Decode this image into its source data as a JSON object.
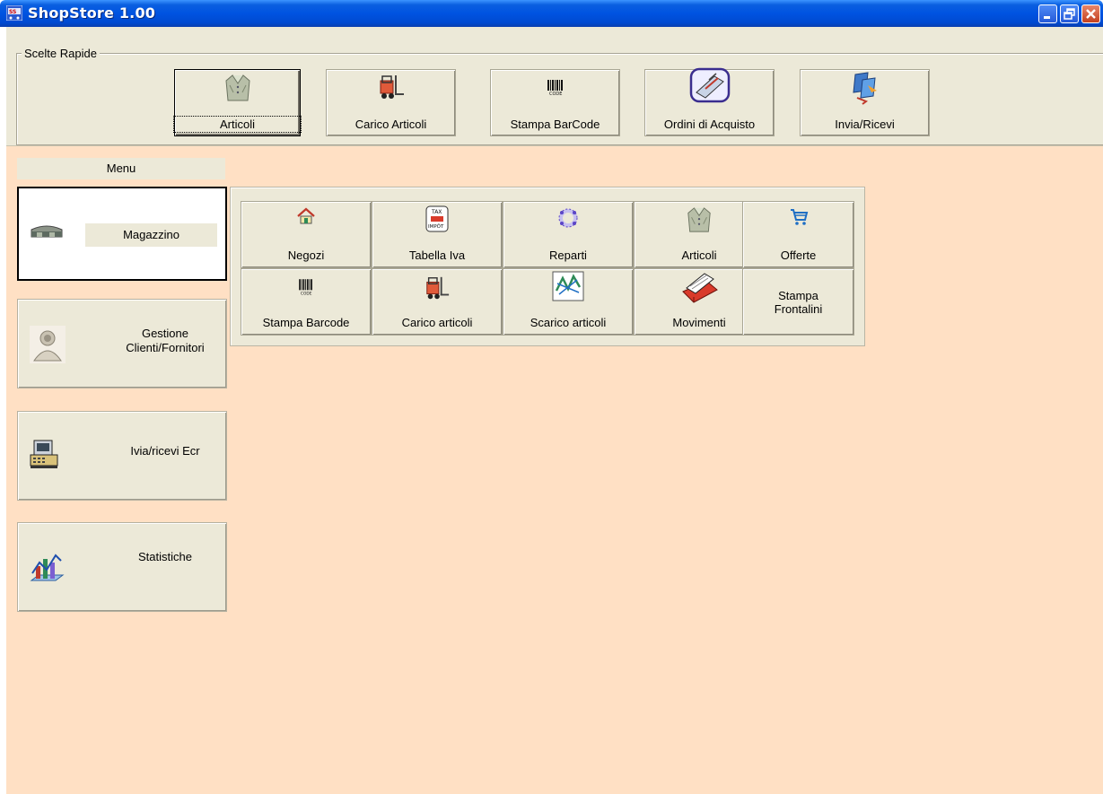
{
  "window": {
    "title": "ShopStore 1.00",
    "colors": {
      "titlebar": "#0054e3",
      "client": "#ffe0c4",
      "panel": "#ece9d8"
    }
  },
  "quick_choices": {
    "legend": "Scelte Rapide",
    "buttons": [
      {
        "label": "Articoli",
        "icon": "jacket-icon",
        "focused": true
      },
      {
        "label": "Carico Articoli",
        "icon": "forklift-icon"
      },
      {
        "label": "Stampa BarCode",
        "icon": "barcode-icon"
      },
      {
        "label": "Ordini di Acquisto",
        "icon": "scanner-icon"
      },
      {
        "label": "Invia/Ricevi",
        "icon": "send-receive-icon"
      }
    ]
  },
  "menu": {
    "header": "Menu",
    "items": [
      {
        "label": "Magazzino",
        "icon": "warehouse-icon",
        "active": true
      },
      {
        "label": "Gestione\nClienti/Fornitori",
        "icon": "customers-icon"
      },
      {
        "label": "Ivia/ricevi Ecr",
        "icon": "cash-register-icon"
      },
      {
        "label": "Statistiche",
        "icon": "statistics-chart-icon"
      }
    ]
  },
  "submenu": {
    "buttons": [
      {
        "label": "Negozi",
        "icon": "house-icon"
      },
      {
        "label": "Tabella Iva",
        "icon": "tax-icon",
        "icon_text": [
          "TAX",
          "IMPÔT"
        ]
      },
      {
        "label": "Reparti",
        "icon": "departments-icon"
      },
      {
        "label": "Articoli",
        "icon": "jacket-icon"
      },
      {
        "label": "Offerte",
        "icon": "shopping-cart-icon"
      },
      {
        "label": "Stampa Barcode",
        "icon": "barcode-icon"
      },
      {
        "label": "Carico articoli",
        "icon": "forklift-icon"
      },
      {
        "label": "Scarico articoli",
        "icon": "unload-icon"
      },
      {
        "label": "Movimenti",
        "icon": "card-index-icon"
      },
      {
        "label": "Stampa\nFrontalini",
        "icon": ""
      }
    ]
  }
}
